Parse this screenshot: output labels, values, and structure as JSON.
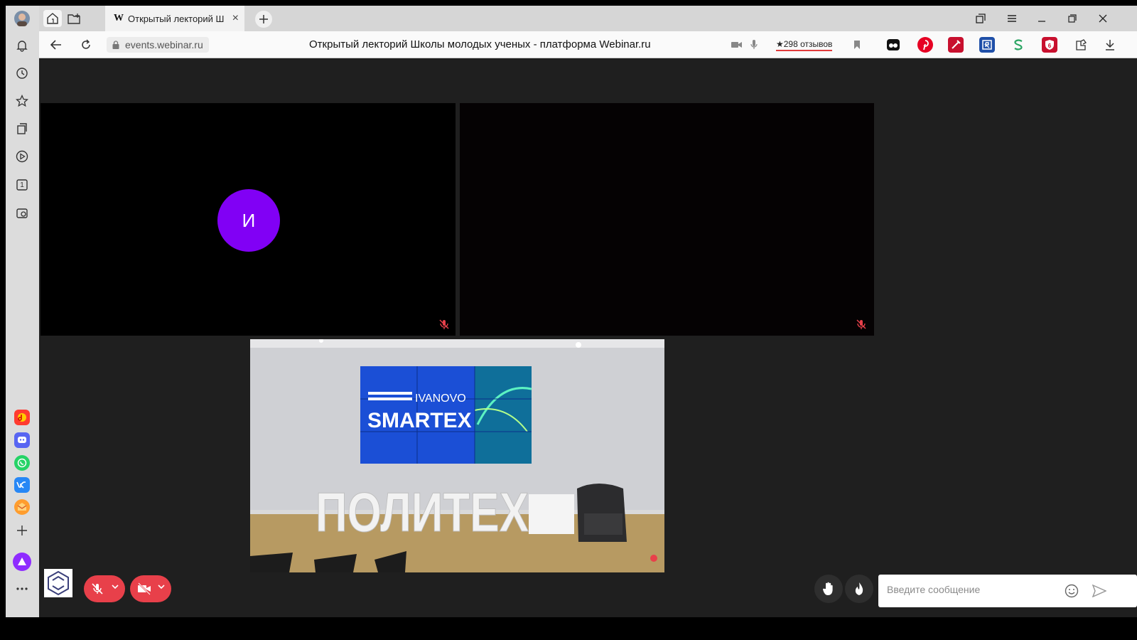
{
  "browser": {
    "tab": {
      "favicon": "W",
      "title": "Открытый лекторий Ш",
      "close_icon": "×"
    },
    "url": "events.webinar.ru",
    "page_title": "Открытый лекторий Школы молодых ученых - платформа Webinar.ru",
    "reviews": "★298 отзывов"
  },
  "sidebar": {
    "items": [
      "bell-icon",
      "history-icon",
      "star-icon",
      "collections-icon",
      "play-icon",
      "tab-count-icon",
      "screenshot-icon"
    ],
    "tab_count": "1",
    "apps": [
      "music-app",
      "discord-app",
      "whatsapp-app",
      "vk-app",
      "mail-app"
    ]
  },
  "conference": {
    "participant_initial": "И",
    "room_sign": "ПОЛИТЕХ",
    "screen_lines": [
      "IVANOVO",
      "SMARTEX"
    ]
  },
  "chat": {
    "placeholder": "Введите сообщение"
  },
  "colors": {
    "accent_red": "#e8404a",
    "avatar_purple": "#8100f5"
  }
}
